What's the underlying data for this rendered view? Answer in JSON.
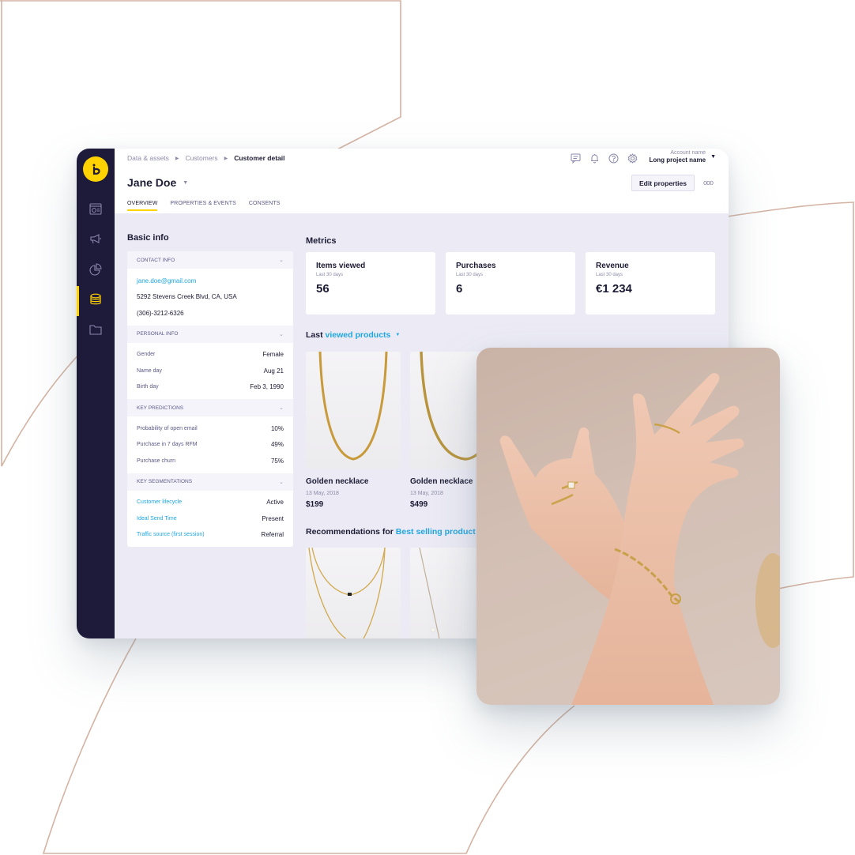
{
  "colors": {
    "accent_yellow": "#ffd200",
    "sidebar_bg": "#1e1a3a",
    "link_blue": "#1fa6e0",
    "decoration_line": "#d4b3a3",
    "canvas_bg": "#ecebf5"
  },
  "sidebar": {
    "logo": "bloomreach-logo-icon",
    "items": [
      {
        "icon": "dashboard-icon",
        "active": false
      },
      {
        "icon": "megaphone-icon",
        "active": false
      },
      {
        "icon": "pie-chart-icon",
        "active": false
      },
      {
        "icon": "database-icon",
        "active": true
      },
      {
        "icon": "folder-icon",
        "active": false
      }
    ]
  },
  "header": {
    "breadcrumb": [
      "Data & assets",
      "Customers",
      "Customer detail"
    ],
    "customer_name": "Jane Doe",
    "tabs": [
      {
        "label": "OVERVIEW",
        "active": true
      },
      {
        "label": "PROPERTIES & EVENTS",
        "active": false
      },
      {
        "label": "CONSENTS",
        "active": false
      }
    ],
    "icons": [
      "chat-icon",
      "bell-icon",
      "help-icon",
      "gear-icon"
    ],
    "account_name": "Account name",
    "project_name": "Long project name",
    "edit_button": "Edit properties",
    "more_button": "ooo"
  },
  "basic_info": {
    "title": "Basic info",
    "contact": {
      "heading": "CONTACT INFO",
      "email": "jane.doe@gmail.com",
      "address": "5292 Stevens Creek Blvd, CA, USA",
      "phone": "(306)-3212-6326"
    },
    "personal": {
      "heading": "PERSONAL INFO",
      "rows": [
        {
          "key": "Gender",
          "value": "Female"
        },
        {
          "key": "Name day",
          "value": "Aug 21"
        },
        {
          "key": "Birth day",
          "value": "Feb 3, 1990"
        }
      ]
    },
    "predictions": {
      "heading": "KEY PREDICTIONS",
      "rows": [
        {
          "key": "Probability of open email",
          "value": "10%"
        },
        {
          "key": "Purchase in 7 days RFM",
          "value": "49%"
        },
        {
          "key": "Purchase churn",
          "value": "75%"
        }
      ]
    },
    "segmentations": {
      "heading": "KEY SEGMENTATIONS",
      "rows": [
        {
          "key": "Customer lifecycle",
          "value": "Active"
        },
        {
          "key": "Ideal Send Time",
          "value": "Present"
        },
        {
          "key": "Traffic source (first session)",
          "value": "Referral"
        }
      ]
    }
  },
  "metrics": {
    "title": "Metrics",
    "cards": [
      {
        "title": "Items viewed",
        "period": "Last 30 days",
        "value": "56"
      },
      {
        "title": "Purchases",
        "period": "Last 30 days",
        "value": "6"
      },
      {
        "title": "Revenue",
        "period": "Last 30 days",
        "value": "€1 234"
      }
    ]
  },
  "last_viewed": {
    "prefix": "Last",
    "selector": "viewed products",
    "products": [
      {
        "name": "Golden necklace",
        "date": "13 May, 2018",
        "price": "$199"
      },
      {
        "name": "Golden necklace",
        "date": "13 May, 2018",
        "price": "$499"
      }
    ]
  },
  "recommendations": {
    "prefix": "Recommendations for",
    "selector": "Best selling product"
  },
  "photo": {
    "subject": "hands with gold rings and bracelet"
  }
}
